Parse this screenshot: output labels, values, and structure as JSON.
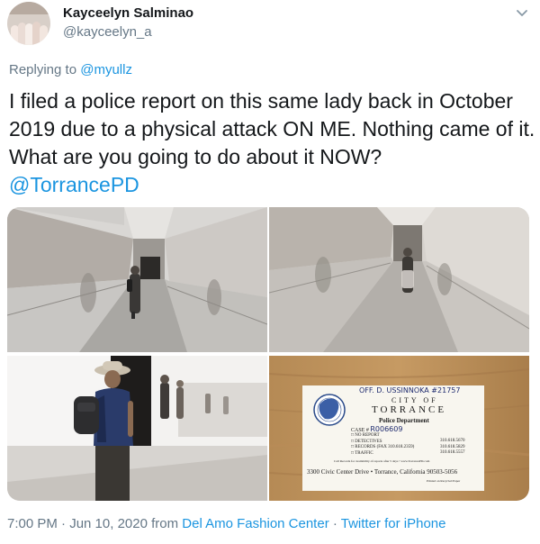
{
  "user": {
    "name": "Kayceelyn Salminao",
    "handle": "@kayceelyn_a"
  },
  "reply": {
    "prefix": "Replying to ",
    "to": "@myullz"
  },
  "tweet": {
    "text": "I filed a police report on this same lady back in October 2019 due to a physical attack ON ME. Nothing came of it. What are you going to do about it NOW?",
    "mention": "@TorrancePD"
  },
  "card": {
    "officer": "OFF. D. USSINNOKA #21757",
    "city_of": "CITY OF",
    "city": "TORRANCE",
    "department": "Police Department",
    "case_label": "CASE #",
    "case_number": "R006609",
    "options": [
      "NO REPORT",
      "DETECTIVES",
      "RECORDS (FAX 310.618.2359)",
      "TRAFFIC"
    ],
    "phones": [
      "310.618.5670",
      "310.618.5829",
      "310.618.5557"
    ],
    "note": "Call Records for availability of reports after 5 days • www.TorrancePD.com",
    "address": "3300 Civic Center Drive • Torrance, California 90503-5056",
    "printed": "Printed on Recycled Paper"
  },
  "meta": {
    "time": "7:00 PM · Jun 10, 2020 from ",
    "place": "Del Amo Fashion Center",
    "sep": " · ",
    "client": "Twitter for iPhone"
  },
  "colors": {
    "link": "#1b95e0",
    "secondary": "#657786",
    "text": "#14171a"
  },
  "icons": {
    "menu": "chevron-down-icon"
  }
}
